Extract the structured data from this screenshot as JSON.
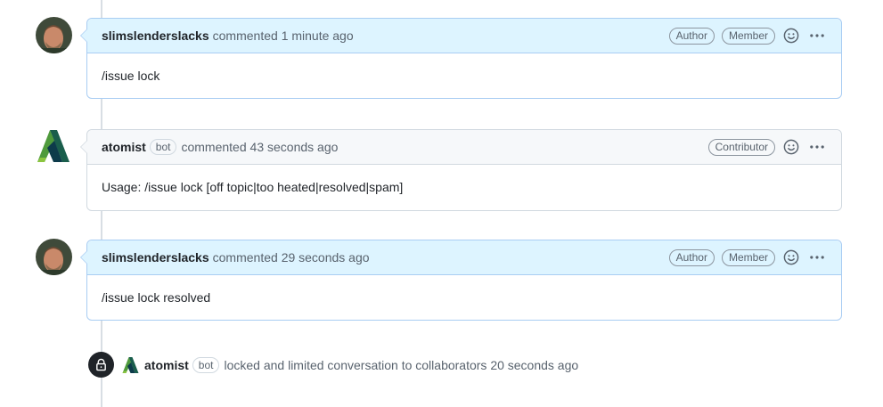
{
  "comments": [
    {
      "username": "slimslenderslacks",
      "action": "commented",
      "time": "1 minute ago",
      "badges": [
        "Author",
        "Member"
      ],
      "body": "/issue lock"
    },
    {
      "username": "atomist",
      "bot_label": "bot",
      "action": "commented",
      "time": "43 seconds ago",
      "badges": [
        "Contributor"
      ],
      "body": "Usage: /issue lock [off topic|too heated|resolved|spam]"
    },
    {
      "username": "slimslenderslacks",
      "action": "commented",
      "time": "29 seconds ago",
      "badges": [
        "Author",
        "Member"
      ],
      "body": "/issue lock resolved"
    }
  ],
  "event": {
    "username": "atomist",
    "bot_label": "bot",
    "text": "locked and limited conversation to collaborators",
    "time": "20 seconds ago"
  },
  "icons": {
    "reaction": "smiley-icon",
    "menu": "kebab-horizontal-icon",
    "lock": "lock-icon",
    "bot_logo": "atomist-logo-icon"
  },
  "colors": {
    "author_header_bg": "#ddf4ff",
    "author_border": "#a9cdf3",
    "other_header_bg": "#f6f8fa",
    "other_border": "#d1d9e0",
    "lock_badge_bg": "#1f2328"
  }
}
